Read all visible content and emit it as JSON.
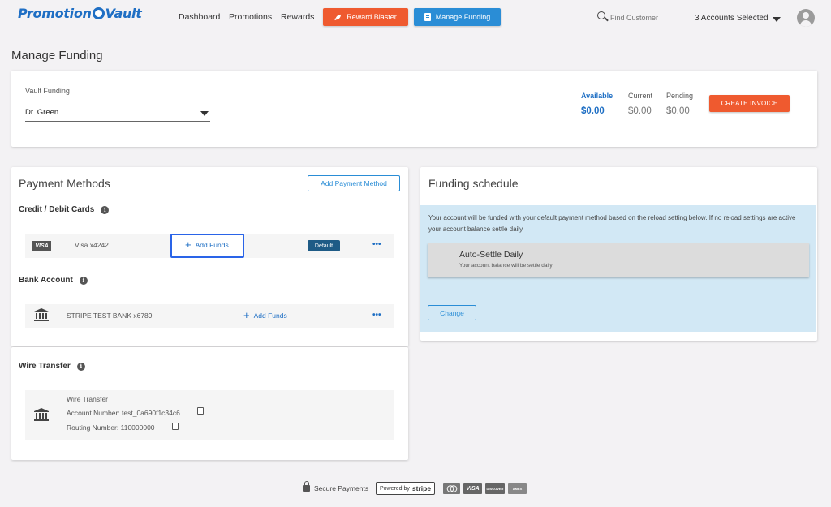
{
  "header": {
    "logo_left": "Promotion",
    "logo_right": "Vault",
    "nav": [
      "Dashboard",
      "Promotions",
      "Rewards"
    ],
    "reward_blaster": "Reward Blaster",
    "manage_funding": "Manage Funding",
    "search_placeholder": "Find Customer",
    "accounts_selected": "3 Accounts Selected"
  },
  "page": {
    "title": "Manage Funding"
  },
  "vault": {
    "label": "Vault Funding",
    "selected": "Dr. Green",
    "available_label": "Available",
    "available_value": "$0.00",
    "current_label": "Current",
    "current_value": "$0.00",
    "pending_label": "Pending",
    "pending_value": "$0.00",
    "create_invoice": "CREATE INVOICE"
  },
  "payment_methods": {
    "title": "Payment Methods",
    "add_button": "Add Payment Method",
    "cards_title": "Credit / Debit Cards",
    "card": {
      "brand_badge": "VISA",
      "label": "Visa  x4242",
      "add_funds": "Add Funds",
      "default": "Default"
    },
    "bank_title": "Bank Account",
    "bank": {
      "label": "STRIPE TEST BANK  x6789",
      "add_funds": "Add Funds"
    },
    "wire_title": "Wire Transfer",
    "wire": {
      "heading": "Wire Transfer",
      "account_number": "Account Number:  test_0a690f1c34c6",
      "routing_number": "Routing Number:  110000000"
    },
    "more": "•••",
    "info": "i",
    "plus": "+"
  },
  "funding_schedule": {
    "title": "Funding schedule",
    "description": "Your account will be funded with your default payment method based on the reload setting below. If no reload settings are active your account balance settle daily.",
    "option_title": "Auto-Settle Daily",
    "option_subtitle": "Your account balance will be settle daily",
    "change": "Change"
  },
  "footer": {
    "secure": "Secure Payments",
    "powered_by": "Powered by",
    "stripe": "stripe",
    "logos": [
      "",
      "VISA",
      "DISCOVER",
      "AMEX"
    ]
  },
  "colors": {
    "orange": "#ef5a2f",
    "blue": "#2a8dd6",
    "highlight": "#2a64e8",
    "navy": "#1e5b86",
    "schedule_bg": "#d2e8f5"
  }
}
